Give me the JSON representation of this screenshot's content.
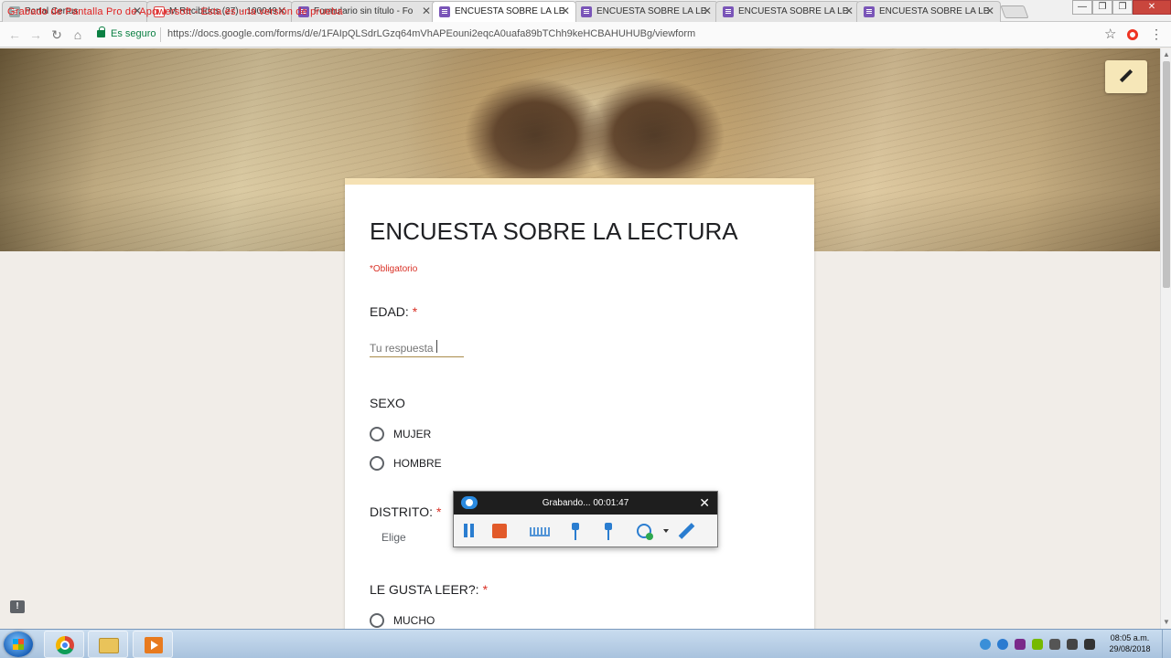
{
  "watermark": "Grabado de Pantalla Pro de Apowersoft - Esta es una versión de prueba",
  "tabs": [
    {
      "label": "Portal Certus",
      "icon": "portal-icon",
      "active": false
    },
    {
      "label": "M Recibidos (27) - 100049",
      "icon": "gmail-icon",
      "active": false
    },
    {
      "label": "Formulario sin título - Fo",
      "icon": "forms-icon",
      "active": false
    },
    {
      "label": "ENCUESTA SOBRE LA LEC",
      "icon": "forms-icon",
      "active": true
    },
    {
      "label": "ENCUESTA SOBRE LA LEC",
      "icon": "forms-icon",
      "active": false
    },
    {
      "label": "ENCUESTA SOBRE LA LEC",
      "icon": "forms-icon",
      "active": false
    },
    {
      "label": "ENCUESTA SOBRE LA LEC",
      "icon": "forms-icon",
      "active": false
    }
  ],
  "tab_close": "✕",
  "window_controls": {
    "minimize": "—",
    "maximize": "❐",
    "close": "✕"
  },
  "address_bar": {
    "secure_label": "Es seguro",
    "url": "https://docs.google.com/forms/d/e/1FAIpQLSdrLGzq64mVhAPEouni2eqcA0uafa89bTChh9keHCBAHUHUBg/viewform",
    "back": "←",
    "forward": "→",
    "reload": "↻",
    "home": "⌂",
    "star": "☆",
    "menu": "⋮"
  },
  "form": {
    "title": "ENCUESTA SOBRE LA LECTURA",
    "required_note": "*Obligatorio",
    "questions": [
      {
        "label": "EDAD:",
        "required": "*",
        "placeholder": "Tu respuesta"
      },
      {
        "label": "SEXO",
        "options": [
          "MUJER",
          "HOMBRE"
        ]
      },
      {
        "label": "DISTRITO:",
        "required": "*",
        "placeholder": "Elige"
      },
      {
        "label": "LE GUSTA LEER?:",
        "required": "*",
        "options": [
          "MUCHO"
        ]
      }
    ]
  },
  "feedback_label": "!",
  "recorder": {
    "status": "Grabando... 00:01:47",
    "close": "✕"
  },
  "taskbar": {
    "apps": [
      "chrome-icon",
      "folder-icon",
      "media-player-icon"
    ],
    "time": "08:05 a.m.",
    "date": "29/08/2018"
  }
}
